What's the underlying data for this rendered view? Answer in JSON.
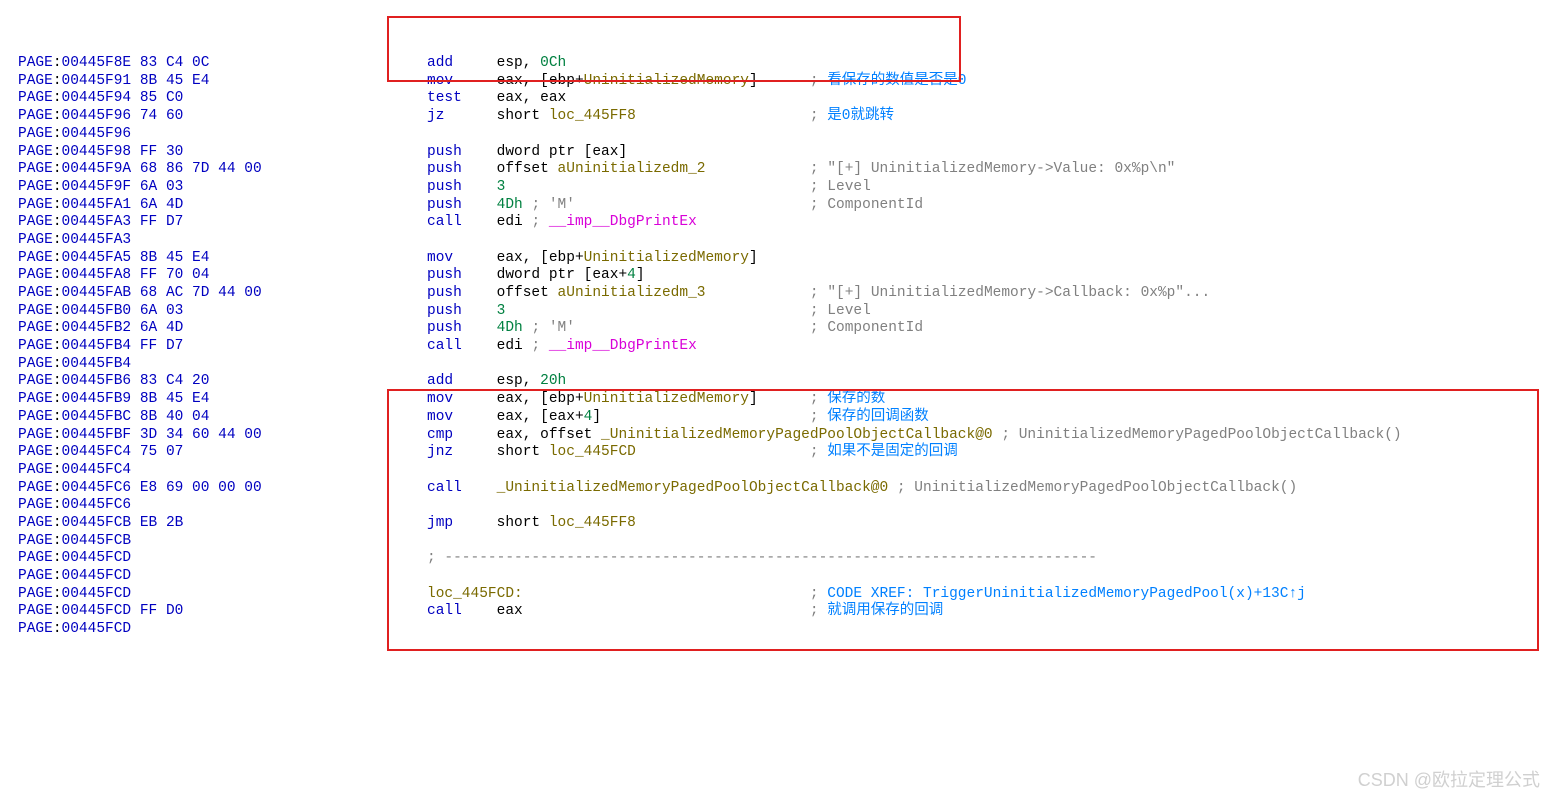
{
  "lines": [
    {
      "a": "00445F8E",
      "b": "83 C4 0C",
      "m": "add",
      "o": [
        [
          "op",
          "esp, "
        ],
        [
          "num",
          "0Ch"
        ]
      ]
    },
    {
      "a": "00445F91",
      "b": "8B 45 E4",
      "m": "mov",
      "o": [
        [
          "op",
          "eax, [ebp+"
        ],
        [
          "var",
          "UninitializedMemory"
        ],
        [
          "op",
          "]"
        ]
      ],
      "c": "看保存的数值是否是0"
    },
    {
      "a": "00445F94",
      "b": "85 C0",
      "m": "test",
      "o": [
        [
          "op",
          "eax, eax"
        ]
      ]
    },
    {
      "a": "00445F96",
      "b": "74 60",
      "m": "jz",
      "o": [
        [
          "op",
          "short "
        ],
        [
          "lbl",
          "loc_445FF8"
        ]
      ],
      "c": "是0就跳转"
    },
    {
      "a": "00445F96",
      "b": ""
    },
    {
      "a": "00445F98",
      "b": "FF 30",
      "m": "push",
      "o": [
        [
          "op",
          "dword ptr [eax]"
        ]
      ]
    },
    {
      "a": "00445F9A",
      "b": "68 86 7D 44 00",
      "m": "push",
      "o": [
        [
          "op",
          "offset "
        ],
        [
          "lbl",
          "aUninitializedm_2"
        ]
      ],
      "c2": "\"[+] UninitializedMemory->Value: 0x%p\\n\""
    },
    {
      "a": "00445F9F",
      "b": "6A 03",
      "m": "push",
      "o": [
        [
          "num",
          "3"
        ]
      ],
      "c2": "Level"
    },
    {
      "a": "00445FA1",
      "b": "6A 4D",
      "m": "push",
      "o": [
        [
          "num",
          "4Dh "
        ],
        [
          "cmt",
          "; "
        ],
        [
          "str",
          "'M'"
        ]
      ],
      "c2": "ComponentId"
    },
    {
      "a": "00445FA3",
      "b": "FF D7",
      "m": "call",
      "o": [
        [
          "op",
          "edi "
        ],
        [
          "cmt",
          "; "
        ],
        [
          "imp",
          "__imp__DbgPrintEx"
        ]
      ]
    },
    {
      "a": "00445FA3",
      "b": ""
    },
    {
      "a": "00445FA5",
      "b": "8B 45 E4",
      "m": "mov",
      "o": [
        [
          "op",
          "eax, [ebp+"
        ],
        [
          "var",
          "UninitializedMemory"
        ],
        [
          "op",
          "]"
        ]
      ]
    },
    {
      "a": "00445FA8",
      "b": "FF 70 04",
      "m": "push",
      "o": [
        [
          "op",
          "dword ptr [eax+"
        ],
        [
          "num",
          "4"
        ],
        [
          "op",
          "]"
        ]
      ]
    },
    {
      "a": "00445FAB",
      "b": "68 AC 7D 44 00",
      "m": "push",
      "o": [
        [
          "op",
          "offset "
        ],
        [
          "lbl",
          "aUninitializedm_3"
        ]
      ],
      "c2": "\"[+] UninitializedMemory->Callback: 0x%p\"..."
    },
    {
      "a": "00445FB0",
      "b": "6A 03",
      "m": "push",
      "o": [
        [
          "num",
          "3"
        ]
      ],
      "c2": "Level"
    },
    {
      "a": "00445FB2",
      "b": "6A 4D",
      "m": "push",
      "o": [
        [
          "num",
          "4Dh "
        ],
        [
          "cmt",
          "; "
        ],
        [
          "str",
          "'M'"
        ]
      ],
      "c2": "ComponentId"
    },
    {
      "a": "00445FB4",
      "b": "FF D7",
      "m": "call",
      "o": [
        [
          "op",
          "edi "
        ],
        [
          "cmt",
          "; "
        ],
        [
          "imp",
          "__imp__DbgPrintEx"
        ]
      ]
    },
    {
      "a": "00445FB4",
      "b": ""
    },
    {
      "a": "00445FB6",
      "b": "83 C4 20",
      "m": "add",
      "o": [
        [
          "op",
          "esp, "
        ],
        [
          "num",
          "20h"
        ]
      ]
    },
    {
      "a": "00445FB9",
      "b": "8B 45 E4",
      "m": "mov",
      "o": [
        [
          "op",
          "eax, [ebp+"
        ],
        [
          "var",
          "UninitializedMemory"
        ],
        [
          "op",
          "]"
        ]
      ],
      "c": "保存的数"
    },
    {
      "a": "00445FBC",
      "b": "8B 40 04",
      "m": "mov",
      "o": [
        [
          "op",
          "eax, [eax+"
        ],
        [
          "num",
          "4"
        ],
        [
          "op",
          "]"
        ]
      ],
      "c": "保存的回调函数"
    },
    {
      "a": "00445FBF",
      "b": "3D 34 60 44 00",
      "m": "cmp",
      "o": [
        [
          "op",
          "eax, offset "
        ],
        [
          "lbl",
          "_UninitializedMemoryPagedPoolObjectCallback@0"
        ],
        [
          "cmt",
          " ; UninitializedMemoryPagedPoolObjectCallback()"
        ]
      ]
    },
    {
      "a": "00445FC4",
      "b": "75 07",
      "m": "jnz",
      "o": [
        [
          "op",
          "short "
        ],
        [
          "lbl",
          "loc_445FCD"
        ]
      ],
      "c": "如果不是固定的回调"
    },
    {
      "a": "00445FC4",
      "b": ""
    },
    {
      "a": "00445FC6",
      "b": "E8 69 00 00 00",
      "m": "call",
      "o": [
        [
          "lbl",
          "_UninitializedMemoryPagedPoolObjectCallback@0"
        ],
        [
          "cmt",
          " ; UninitializedMemoryPagedPoolObjectCallback()"
        ]
      ]
    },
    {
      "a": "00445FC6",
      "b": ""
    },
    {
      "a": "00445FCB",
      "b": "EB 2B",
      "m": "jmp",
      "o": [
        [
          "op",
          "short "
        ],
        [
          "lbl",
          "loc_445FF8"
        ]
      ]
    },
    {
      "a": "00445FCB",
      "b": ""
    },
    {
      "a": "00445FCD",
      "b": "",
      "sep": true
    },
    {
      "a": "00445FCD",
      "b": ""
    },
    {
      "a": "00445FCD",
      "b": "",
      "label": "loc_445FCD:",
      "xref": "CODE XREF: TriggerUninitializedMemoryPagedPool(x)+13C↑j"
    },
    {
      "a": "00445FCD",
      "b": "FF D0",
      "m": "call",
      "o": [
        [
          "op",
          "eax"
        ]
      ],
      "c": "就调用保存的回调"
    },
    {
      "a": "00445FCD",
      "b": ""
    }
  ],
  "watermark": "CSDN @欧拉定理公式"
}
